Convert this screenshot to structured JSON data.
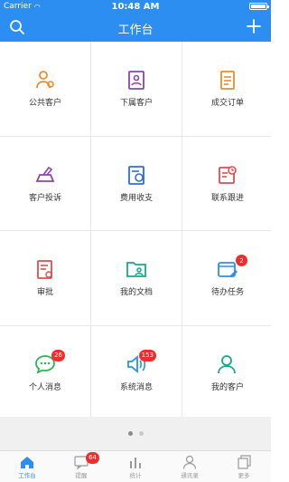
{
  "status_bar": {
    "carrier": "Carrier",
    "time": "10:48 AM"
  },
  "nav": {
    "title": "工作台"
  },
  "grid": [
    {
      "label": "公共客户",
      "icon": "public-customers-icon",
      "color": "#f08a2b"
    },
    {
      "label": "下属客户",
      "icon": "subordinate-customers-icon",
      "color": "#8e44ad"
    },
    {
      "label": "成交订单",
      "icon": "deal-orders-icon",
      "color": "#f08a2b"
    },
    {
      "label": "客户投诉",
      "icon": "complaint-icon",
      "color": "#8e44ad"
    },
    {
      "label": "费用收支",
      "icon": "expenses-icon",
      "color": "#2b6fd6"
    },
    {
      "label": "联系跟进",
      "icon": "follow-up-icon",
      "color": "#e24c4c"
    },
    {
      "label": "审批",
      "icon": "approval-icon",
      "color": "#e24c4c"
    },
    {
      "label": "我的文档",
      "icon": "my-documents-icon",
      "color": "#1aa98c"
    },
    {
      "label": "待办任务",
      "icon": "todo-tasks-icon",
      "color": "#2b8ef0",
      "badge": "2"
    },
    {
      "label": "个人消息",
      "icon": "personal-message-icon",
      "color": "#2bb552",
      "badge": "26"
    },
    {
      "label": "系统消息",
      "icon": "system-message-icon",
      "color": "#2b8ef0",
      "badge": "153"
    },
    {
      "label": "我的客户",
      "icon": "my-customers-icon",
      "color": "#1aa98c"
    }
  ],
  "tabs": [
    {
      "label": "工作台",
      "icon": "home-icon",
      "active": true
    },
    {
      "label": "提醒",
      "icon": "reminder-icon",
      "badge": "64"
    },
    {
      "label": "统计",
      "icon": "statistics-icon"
    },
    {
      "label": "通讯录",
      "icon": "contacts-icon"
    },
    {
      "label": "更多",
      "icon": "more-icon"
    }
  ],
  "colors": {
    "primary": "#2b8ef0",
    "badge": "#f02d2d"
  }
}
